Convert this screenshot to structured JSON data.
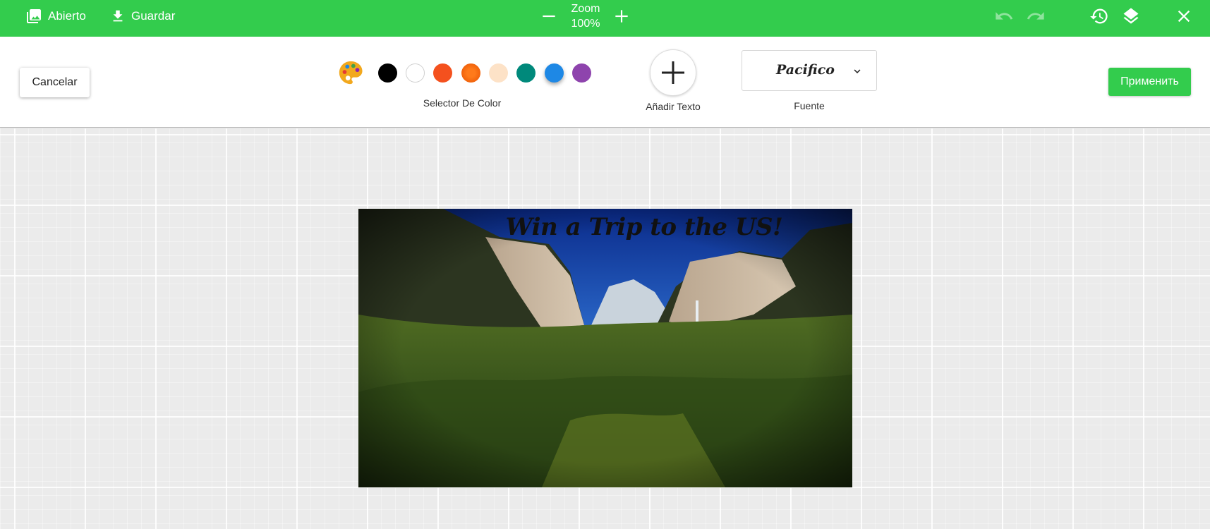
{
  "topbar": {
    "open_label": "Abierto",
    "save_label": "Guardar",
    "zoom_label": "Zoom",
    "zoom_value": "100%",
    "undo_icon": "undo-icon",
    "redo_icon": "redo-icon",
    "history_icon": "history-icon",
    "layers_icon": "layers-icon",
    "close_icon": "close-icon",
    "bar_color": "#33cc4d"
  },
  "toolbar": {
    "cancel_label": "Cancelar",
    "color_picker_label": "Selector De Color",
    "add_text_label": "Añadir Texto",
    "font_value": "Pacifico",
    "font_label": "Fuente",
    "apply_label": "Применить",
    "swatches": [
      {
        "name": "black",
        "color": "#000000"
      },
      {
        "name": "white",
        "color": "#ffffff"
      },
      {
        "name": "orange-red",
        "color": "#f4511e"
      },
      {
        "name": "orange-pattern",
        "color": "#f57c00"
      },
      {
        "name": "peach",
        "color": "#fde2c7"
      },
      {
        "name": "teal",
        "color": "#00897b"
      },
      {
        "name": "blue",
        "color": "#1e88e5",
        "selected": true
      },
      {
        "name": "purple",
        "color": "#8e44ad"
      }
    ]
  },
  "canvas": {
    "caption": "Win a Trip to the US!"
  }
}
